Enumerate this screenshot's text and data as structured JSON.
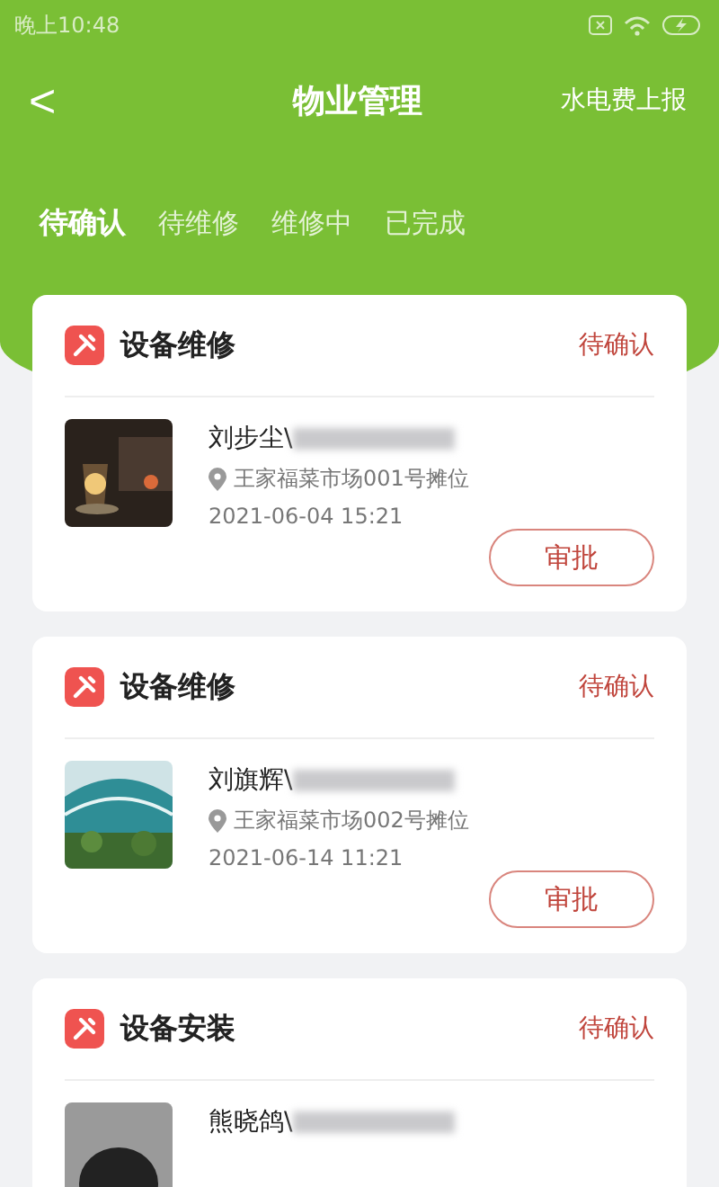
{
  "status_bar": {
    "time": "晚上10:48"
  },
  "header": {
    "back": "<",
    "title": "物业管理",
    "action": "水电费上报"
  },
  "tabs": [
    {
      "label": "待确认",
      "selected": true
    },
    {
      "label": "待维修",
      "selected": false
    },
    {
      "label": "维修中",
      "selected": false
    },
    {
      "label": "已完成",
      "selected": false
    }
  ],
  "cards": [
    {
      "type": "设备维修",
      "status": "待确认",
      "name": "刘步尘\\",
      "address": "王家福菜市场001号摊位",
      "time": "2021-06-04 15:21",
      "button": "审批"
    },
    {
      "type": "设备维修",
      "status": "待确认",
      "name": "刘旗辉\\",
      "address": "王家福菜市场002号摊位",
      "time": "2021-06-14 11:21",
      "button": "审批"
    },
    {
      "type": "设备安装",
      "status": "待确认",
      "name": "熊晓鸽\\"
    }
  ]
}
